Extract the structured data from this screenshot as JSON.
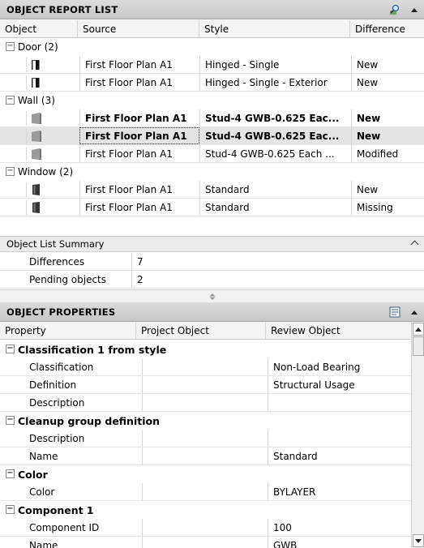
{
  "report_list": {
    "title": "OBJECT REPORT LIST",
    "columns": [
      "Object",
      "Source",
      "Style",
      "Difference"
    ],
    "groups": [
      {
        "label": "Door (2)",
        "toggle": "−",
        "rows": [
          {
            "icon": "door-icon",
            "source": "First Floor Plan A1",
            "style": "Hinged - Single",
            "difference": "New",
            "bold": false,
            "selected": false
          },
          {
            "icon": "door-icon",
            "source": "First Floor Plan A1",
            "style": "Hinged - Single - Exterior",
            "difference": "New",
            "bold": false,
            "selected": false
          }
        ]
      },
      {
        "label": "Wall (3)",
        "toggle": "−",
        "rows": [
          {
            "icon": "wall-icon",
            "source": "First Floor Plan A1",
            "style": "Stud-4 GWB-0.625 Eac...",
            "difference": "New",
            "bold": true,
            "selected": false
          },
          {
            "icon": "wall-icon",
            "source": "First Floor Plan A1",
            "style": "Stud-4 GWB-0.625 Eac...",
            "difference": "New",
            "bold": true,
            "selected": true
          },
          {
            "icon": "wall-icon",
            "source": "First Floor Plan A1",
            "style": "Stud-4 GWB-0.625 Each ...",
            "difference": "Modified",
            "bold": false,
            "selected": false
          }
        ]
      },
      {
        "label": "Window (2)",
        "toggle": "−",
        "rows": [
          {
            "icon": "window-icon",
            "source": "First Floor Plan A1",
            "style": "Standard",
            "difference": "New",
            "bold": false,
            "selected": false
          },
          {
            "icon": "window-icon",
            "source": "First Floor Plan A1",
            "style": "Standard",
            "difference": "Missing",
            "bold": false,
            "selected": false
          }
        ]
      }
    ]
  },
  "summary": {
    "title": "Object List Summary",
    "rows": [
      {
        "label": "Differences",
        "value": "7"
      },
      {
        "label": "Pending objects",
        "value": "2"
      }
    ]
  },
  "properties": {
    "title": "OBJECT PROPERTIES",
    "columns": [
      "Property",
      "Project Object",
      "Review Object"
    ],
    "categories": [
      {
        "label": "Classification 1 from style",
        "toggle": "−",
        "rows": [
          {
            "property": "Classification",
            "project": "",
            "review": "Non-Load Bearing"
          },
          {
            "property": "Definition",
            "project": "",
            "review": "Structural Usage"
          },
          {
            "property": "Description",
            "project": "",
            "review": ""
          }
        ]
      },
      {
        "label": "Cleanup group definition",
        "toggle": "−",
        "rows": [
          {
            "property": "Description",
            "project": "",
            "review": ""
          },
          {
            "property": "Name",
            "project": "",
            "review": "Standard"
          }
        ]
      },
      {
        "label": "Color",
        "toggle": "−",
        "rows": [
          {
            "property": "Color",
            "project": "",
            "review": "BYLAYER"
          }
        ]
      },
      {
        "label": "Component 1",
        "toggle": "−",
        "rows": [
          {
            "property": "Component ID",
            "project": "",
            "review": "100"
          },
          {
            "property": "Name",
            "project": "",
            "review": "GWB"
          }
        ]
      }
    ]
  },
  "colors": {
    "header_bg": "#cfcfcf",
    "selected_row": "#e4e4e4",
    "icon_gray": "#9a9a9a"
  }
}
